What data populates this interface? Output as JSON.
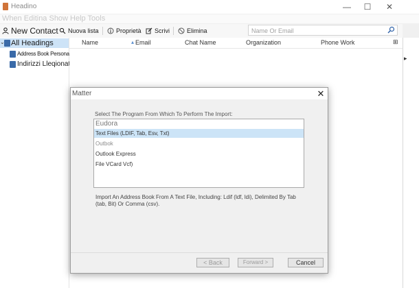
{
  "window": {
    "title": "Headino",
    "minimize": "—",
    "maximize": "☐",
    "close": "✕"
  },
  "hint_text": "When Editina Show Help Tools",
  "toolbar": {
    "new_contact": "New Contact",
    "new_list": "Nuova lista",
    "properties": "Proprietà",
    "write": "Scrivi",
    "delete": "Elimina"
  },
  "search": {
    "placeholder": "Name Or Email"
  },
  "tree": {
    "root": "All Headings",
    "items": [
      "Address Book Personal",
      "Indirizzi Lleqionati"
    ]
  },
  "columns": [
    "Name",
    "Email",
    "Chat Name",
    "Organization",
    "Phone Work"
  ],
  "dialog": {
    "title": "Matter",
    "instruction": "Select The Program From Which To Perform The Import:",
    "options": [
      "Eudora",
      "Text Files (LDIF, Tab, Esv, Txt)",
      "Outbok",
      "Outlook Express",
      "File VCard Vcf)"
    ],
    "selected_index": 1,
    "description": "Import An Address Book From A Text File, Including: Ldif (ldf, ldi), Delimited By Tab (tab, Bit) Or Comma (csv).",
    "back_label": "< Back",
    "forward_label": "Forward >",
    "cancel_label": "Cancel"
  },
  "colors": {
    "selection": "#cce4f7",
    "tree_selection": "#cde3f7",
    "accent_icon": "#d0743a"
  }
}
